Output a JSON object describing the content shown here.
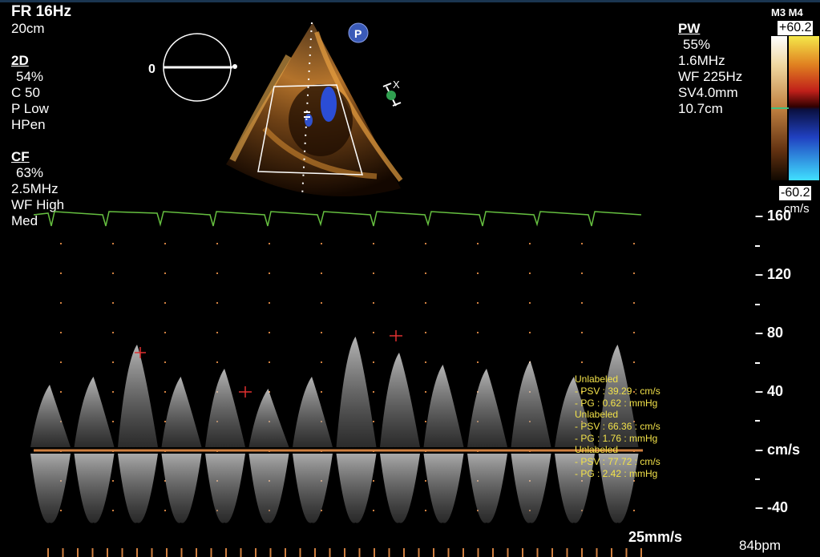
{
  "header": {
    "frame_rate": "FR 16Hz",
    "depth": "20cm"
  },
  "mode_2d": {
    "title": "2D",
    "lines": [
      "54%",
      "C 50",
      "P Low",
      "HPen"
    ]
  },
  "mode_cf": {
    "title": "CF",
    "lines": [
      "63%",
      "2.5MHz",
      "WF High",
      "Med"
    ]
  },
  "mode_pw": {
    "title": "PW",
    "lines": [
      "55%",
      "1.6MHz",
      "WF 225Hz",
      "SV4.0mm",
      "10.7cm"
    ]
  },
  "probe": {
    "angle_label": "0",
    "p_badge": "P"
  },
  "color_scale": {
    "preset": "M3 M4",
    "top_value": "+60.2",
    "bottom_value": "-60.2",
    "unit": "cm/s",
    "colors": {
      "warm_top": "#f4e84a",
      "warm_mid": "#c0201a",
      "cool_mid": "#2040c0",
      "cool_bottom": "#40e0ff"
    }
  },
  "velocity_axis": {
    "labels": [
      "160",
      "120",
      "80",
      "40",
      "cm/s",
      "-40"
    ]
  },
  "measurements": [
    {
      "label": "Unlabeled",
      "psv": "- PSV : 39.29 : cm/s",
      "pg": "- PG : 0.62 : mmHg"
    },
    {
      "label": "Unlabeled",
      "psv": "- PSV : 66.36 : cm/s",
      "pg": "- PG : 1.76 : mmHg"
    },
    {
      "label": "Unlabeled",
      "psv": "- PSV : 77.72 : cm/s",
      "pg": "- PG : 2.42 : mmHg"
    }
  ],
  "footer": {
    "sweep_speed": "25mm/s",
    "heart_rate": "84bpm"
  },
  "colors": {
    "ecg": "#66c040",
    "baseline": "#d08040",
    "caliper": "#e03030",
    "measurement_text": "#f2e24a"
  }
}
